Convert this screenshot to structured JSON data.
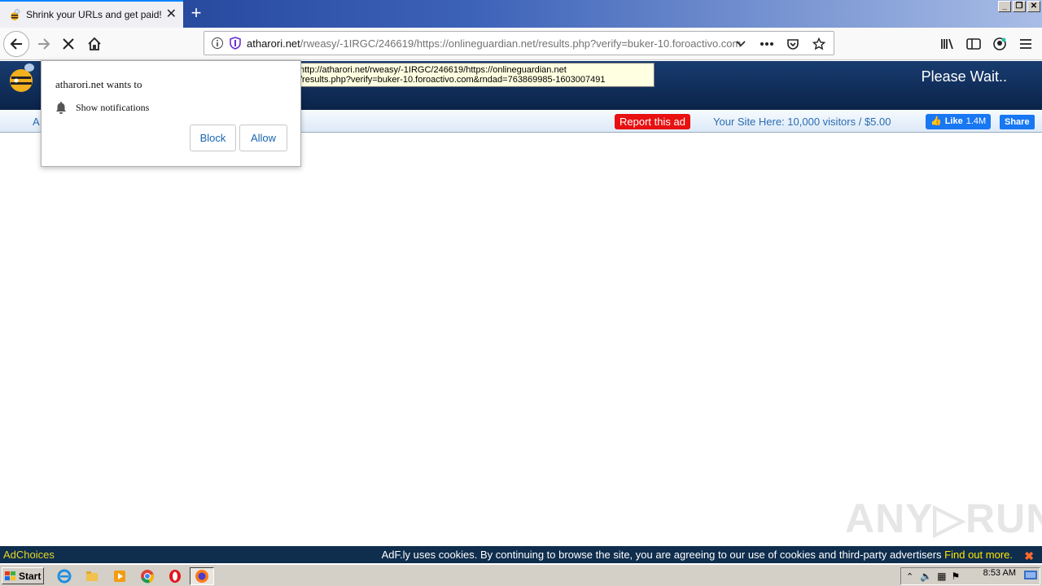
{
  "browser": {
    "tab_title": "Shrink your URLs and get paid!",
    "url_host": "atharori.net",
    "url_path": "/rweasy/-1IRGC/246619/https://onlineguardian.net/results.php?verify=buker-10.foroactivo.com",
    "tooltip_line1": "http://atharori.net/rweasy/-1IRGC/246619/https://onlineguardian.net",
    "tooltip_line2": "/results.php?verify=buker-10.foroactivo.com&rndad=763869985-1603007491"
  },
  "notification": {
    "wants": "atharori.net wants to",
    "permission": "Show notifications",
    "block_label": "Block",
    "allow_label": "Allow"
  },
  "page": {
    "please_wait": "Please Wait..",
    "ad_left_fragment": "A",
    "report_ad": "Report this ad",
    "your_site": "Your Site Here: 10,000 visitors / $5.00",
    "fb_like": "Like",
    "fb_like_count": "1.4M",
    "fb_share": "Share"
  },
  "cookiebar": {
    "adchoices": "AdChoices",
    "text": "AdF.ly uses cookies. By continuing to browse the site, you are agreeing to our use of cookies and third-party advertisers",
    "find_out": "Find out more.",
    "close": "✖"
  },
  "watermark": "ANY▷RUN",
  "taskbar": {
    "start": "Start",
    "clock": "8:53 AM"
  },
  "colors": {
    "report_red": "#e81010",
    "fb_blue": "#1877f2",
    "header_navy": "#0b2348"
  }
}
